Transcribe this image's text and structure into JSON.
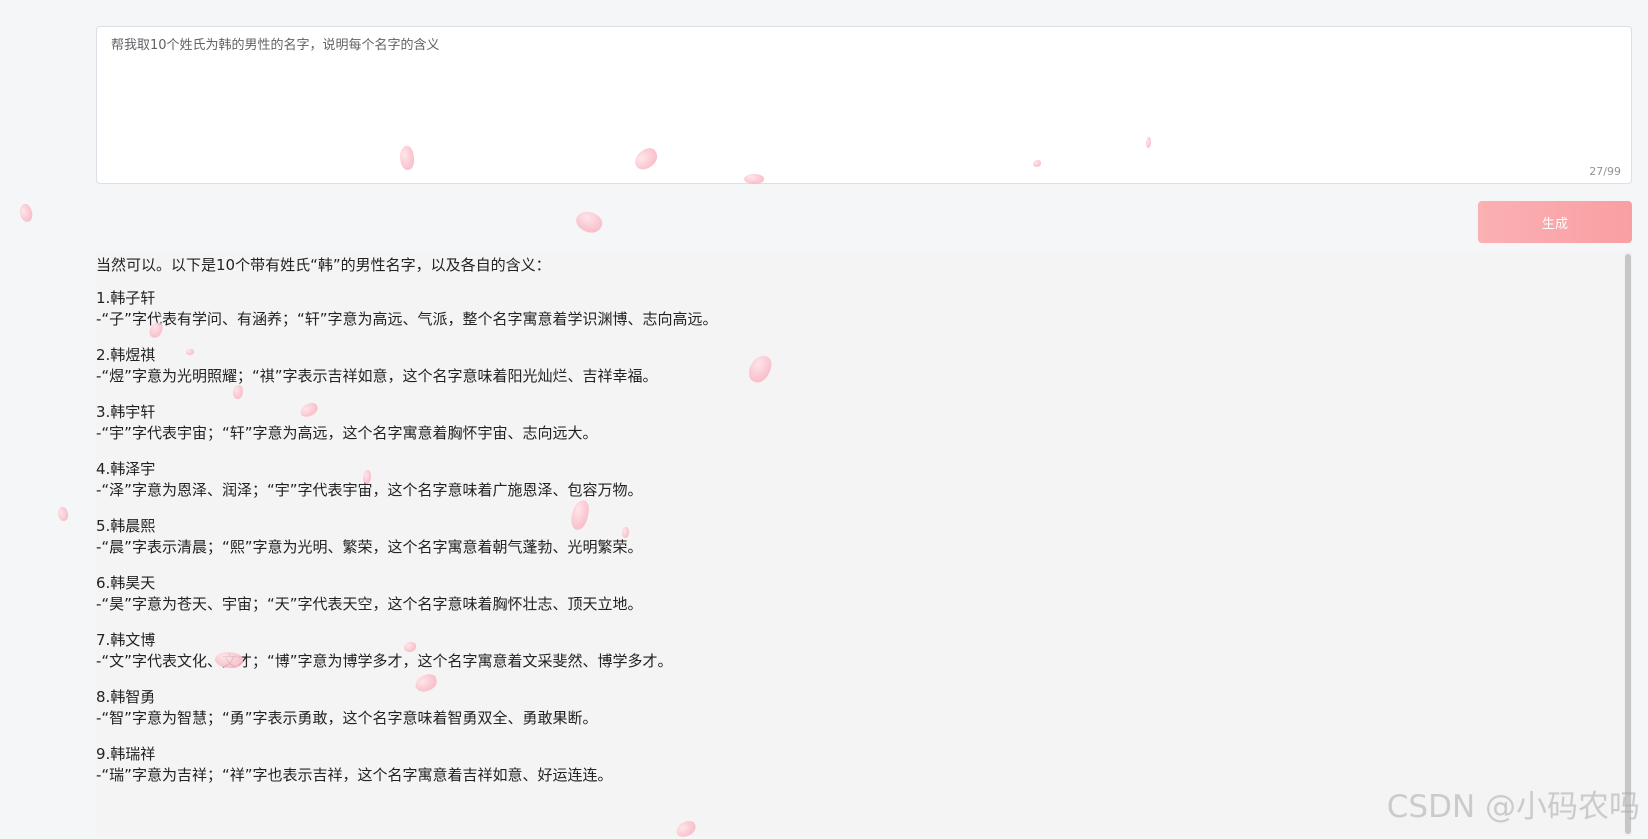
{
  "prompt": {
    "text": "帮我取10个姓氏为韩的男性的名字，说明每个名字的含义",
    "char_count": "27/99"
  },
  "generate_button": {
    "label": "生成"
  },
  "answer": {
    "intro": "当然可以。以下是10个带有姓氏“韩”的男性名字，以及各自的含义：",
    "names": [
      {
        "title": "1.韩子轩",
        "desc": "-“子”字代表有学问、有涵养；“轩”字意为高远、气派，整个名字寓意着学识渊博、志向高远。"
      },
      {
        "title": "2.韩煜祺",
        "desc": "-“煜”字意为光明照耀；“祺”字表示吉祥如意，这个名字意味着阳光灿烂、吉祥幸福。"
      },
      {
        "title": "3.韩宇轩",
        "desc": "-“宇”字代表宇宙；“轩”字意为高远，这个名字寓意着胸怀宇宙、志向远大。"
      },
      {
        "title": "4.韩泽宇",
        "desc": "-“泽”字意为恩泽、润泽；“宇”字代表宇宙，这个名字意味着广施恩泽、包容万物。"
      },
      {
        "title": "5.韩晨熙",
        "desc": "-“晨”字表示清晨；“熙”字意为光明、繁荣，这个名字寓意着朝气蓬勃、光明繁荣。"
      },
      {
        "title": "6.韩昊天",
        "desc": "-“昊”字意为苍天、宇宙；“天”字代表天空，这个名字意味着胸怀壮志、顶天立地。"
      },
      {
        "title": "7.韩文博",
        "desc": "-“文”字代表文化、文才；“博”字意为博学多才，这个名字寓意着文采斐然、博学多才。"
      },
      {
        "title": "8.韩智勇",
        "desc": "-“智”字意为智慧；“勇”字表示勇敢，这个名字意味着智勇双全、勇敢果断。"
      },
      {
        "title": "9.韩瑞祥",
        "desc": "-“瑞”字意为吉祥；“祥”字也表示吉祥，这个名字寓意着吉祥如意、好运连连。"
      }
    ]
  },
  "watermark": "CSDN @小码农吗",
  "colors": {
    "button_gradient_start": "#fbb0b3",
    "button_gradient_end": "#f99fa3",
    "petal": "#f6a9b8"
  }
}
